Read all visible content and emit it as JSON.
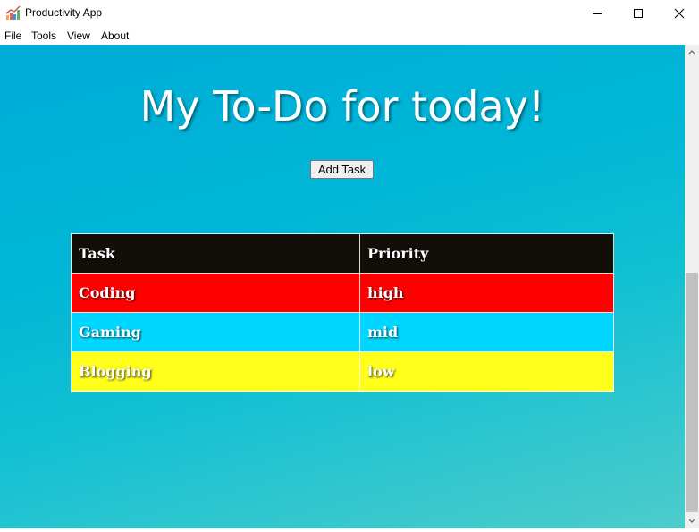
{
  "window": {
    "title": "Productivity App",
    "controls": [
      "minimize",
      "maximize",
      "close"
    ]
  },
  "menu": {
    "items": [
      "File",
      "Tools",
      "View",
      "About"
    ]
  },
  "main": {
    "heading": "My To-Do for today!",
    "add_button_label": "Add Task",
    "table": {
      "headers": [
        "Task",
        "Priority"
      ],
      "header_color": "#110f08",
      "rows": [
        {
          "task": "Coding",
          "priority": "high",
          "color": "#ff0000"
        },
        {
          "task": "Gaming",
          "priority": "mid",
          "color": "#00d6ff"
        },
        {
          "task": "Blogging",
          "priority": "low",
          "color": "#ffff19"
        }
      ]
    }
  },
  "colors": {
    "background_top": "#00acd8",
    "background_bottom": "#4dcccb"
  }
}
